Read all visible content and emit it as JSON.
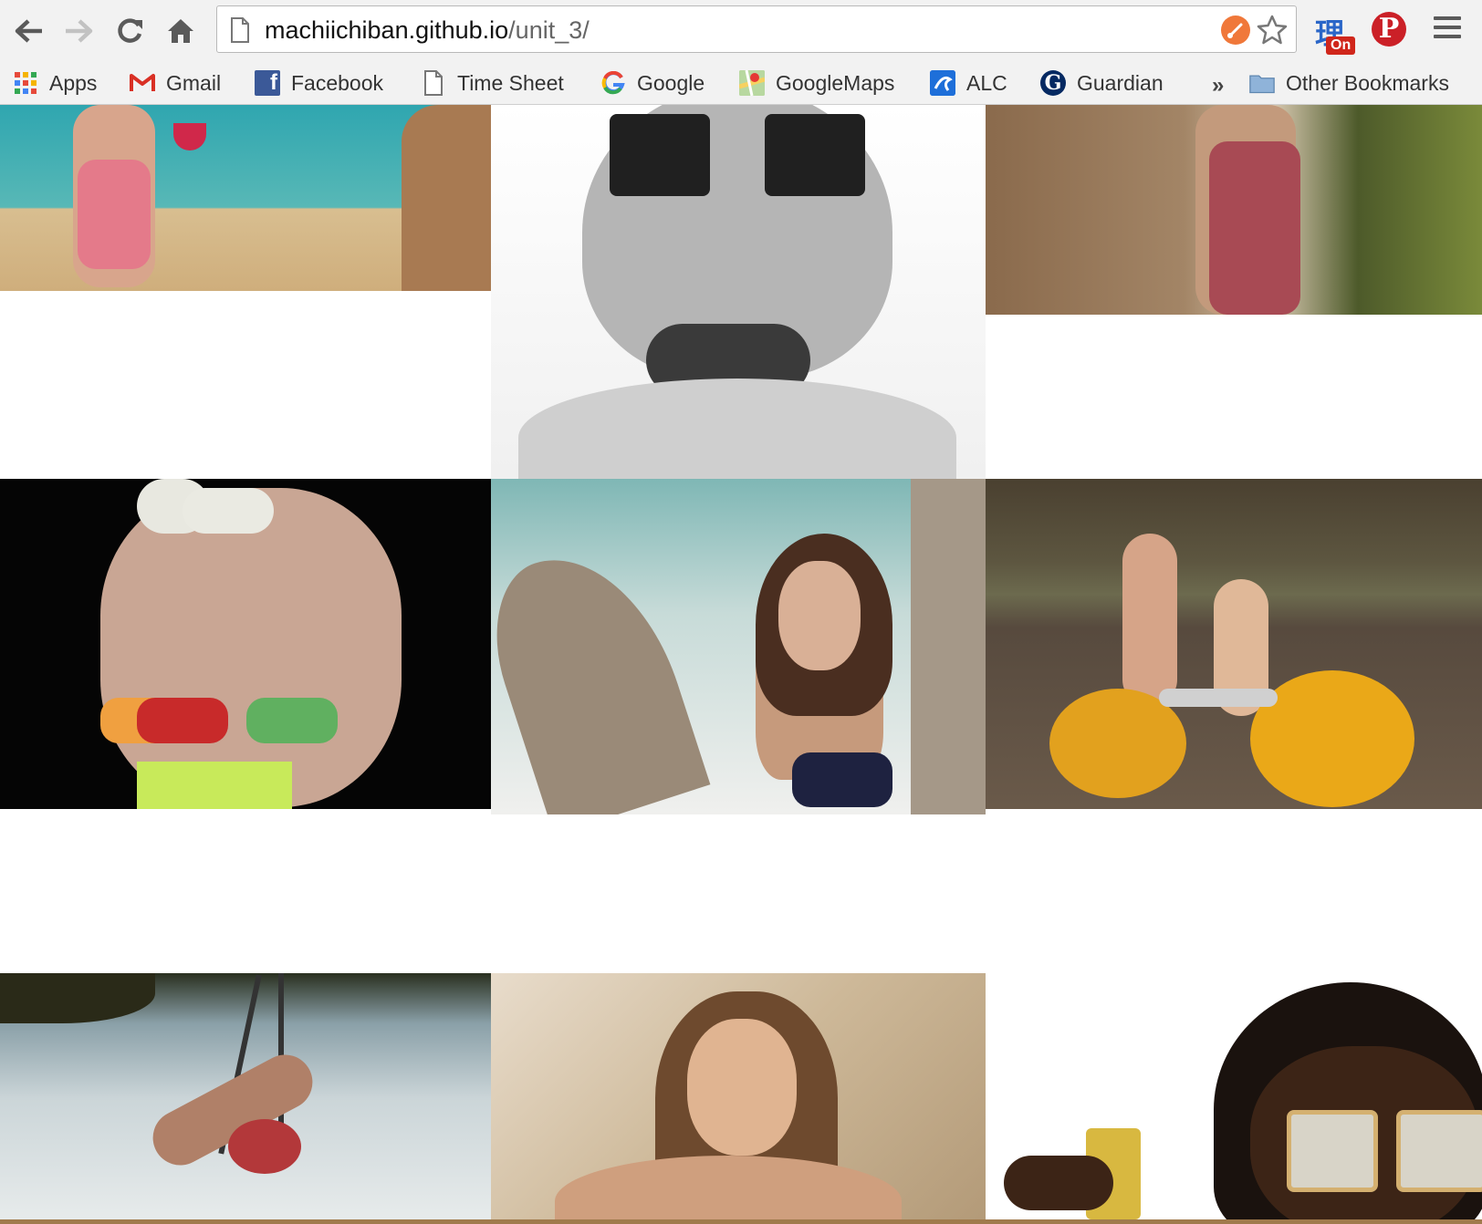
{
  "browser": {
    "url_host": "machiichiban.github.io",
    "url_path": "/unit_3/",
    "extensions": {
      "kanji": "理",
      "kanji_badge": "On",
      "pinterest": "P"
    },
    "more_bookmarks": "»"
  },
  "bookmarks": [
    {
      "label": "Apps",
      "icon": "apps-grid-icon"
    },
    {
      "label": "Gmail",
      "icon": "gmail-icon"
    },
    {
      "label": "Facebook",
      "icon": "facebook-icon"
    },
    {
      "label": "Time Sheet",
      "icon": "document-icon"
    },
    {
      "label": "Google",
      "icon": "google-icon"
    },
    {
      "label": "GoogleMaps",
      "icon": "google-maps-icon"
    },
    {
      "label": "ALC",
      "icon": "alc-icon"
    },
    {
      "label": "Guardian",
      "icon": "guardian-icon"
    },
    {
      "label": "Other Bookmarks",
      "icon": "folder-icon"
    }
  ],
  "gallery": {
    "photos": [
      {
        "subject": "woman in floral swimsuit holding cocktail on beach"
      },
      {
        "subject": "black and white portrait with square sunglasses and choker"
      },
      {
        "subject": "woman in patterned swimsuit against stone wall"
      },
      {
        "subject": "multiple-exposure woman with colorful sunglasses"
      },
      {
        "subject": "woman in navy bikini under palm fronds"
      },
      {
        "subject": "two women on yellow pedal boat in lake"
      },
      {
        "subject": "woman on swing over water"
      },
      {
        "subject": "woman with wet hair, warm tones"
      },
      {
        "subject": "woman with square sunglasses and gold cuff"
      }
    ]
  },
  "colors": {
    "chrome_bg": "#f2f2f2",
    "pinterest_red": "#cb2027",
    "kanji_blue": "#2a66c8"
  }
}
